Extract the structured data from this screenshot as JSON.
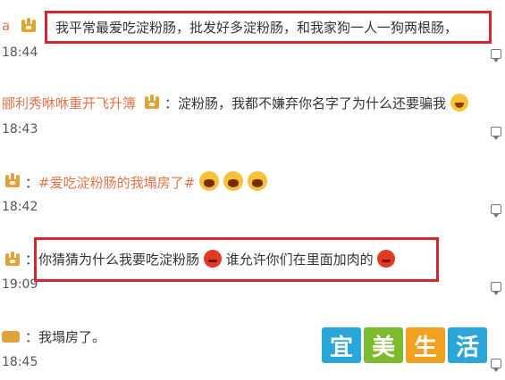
{
  "comments": [
    {
      "username": "a",
      "text": "我平常最爱吃淀粉肠，批发好多淀粉肠，和我家狗一人一狗两根肠，",
      "time": "18:44"
    },
    {
      "username": "郦利秀咻咻重开飞升簿",
      "text": "：淀粉肠，我都不嫌弃你名字了为什么还要骗我",
      "time": "18:43"
    },
    {
      "text_prefix": "：",
      "tag": "#爱吃淀粉肠的我塌房了#",
      "time": "18:42"
    },
    {
      "text_part1": "：你猜猜为什么我要吃淀粉肠",
      "text_part2": "谁允许你们在里面加肉的",
      "time": "19:09"
    },
    {
      "text": "：我塌房了。",
      "time": "18:45"
    }
  ],
  "watermark": [
    "宜",
    "美",
    "生",
    "活"
  ],
  "colors": {
    "highlight": "#d6252e",
    "username": "#e0734a",
    "logo": [
      "#2aa7d8",
      "#7dbb2e",
      "#f2a01f",
      "#2aa7d8"
    ]
  }
}
